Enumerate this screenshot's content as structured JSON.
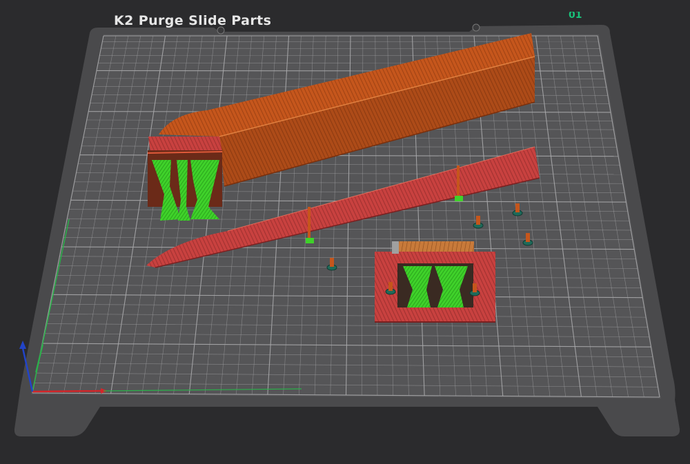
{
  "plate": {
    "title": "K2 Purge Slide Parts",
    "index_label": "01"
  },
  "colors": {
    "background": "#2b2b2d",
    "bed_outer": "#4a4a4c",
    "bed_surface": "#535354",
    "grid_line": "#a9a9ab",
    "part_orange": "#c5561c",
    "part_red": "#c8413f",
    "support_green": "#3fd12a",
    "axis_x": "#d3262a",
    "axis_y": "#2ab24a",
    "axis_z": "#2244c8",
    "index_green": "#19c27a"
  },
  "objects": [
    {
      "name": "Purge slide main body",
      "type": "part",
      "color": "orange"
    },
    {
      "name": "Slide strip",
      "type": "part",
      "color": "red"
    },
    {
      "name": "Base frame",
      "type": "part",
      "color": "red"
    },
    {
      "name": "Tree supports",
      "type": "support",
      "color": "green"
    },
    {
      "name": "Screw pins",
      "type": "part",
      "color": "orange",
      "count": 6
    }
  ]
}
